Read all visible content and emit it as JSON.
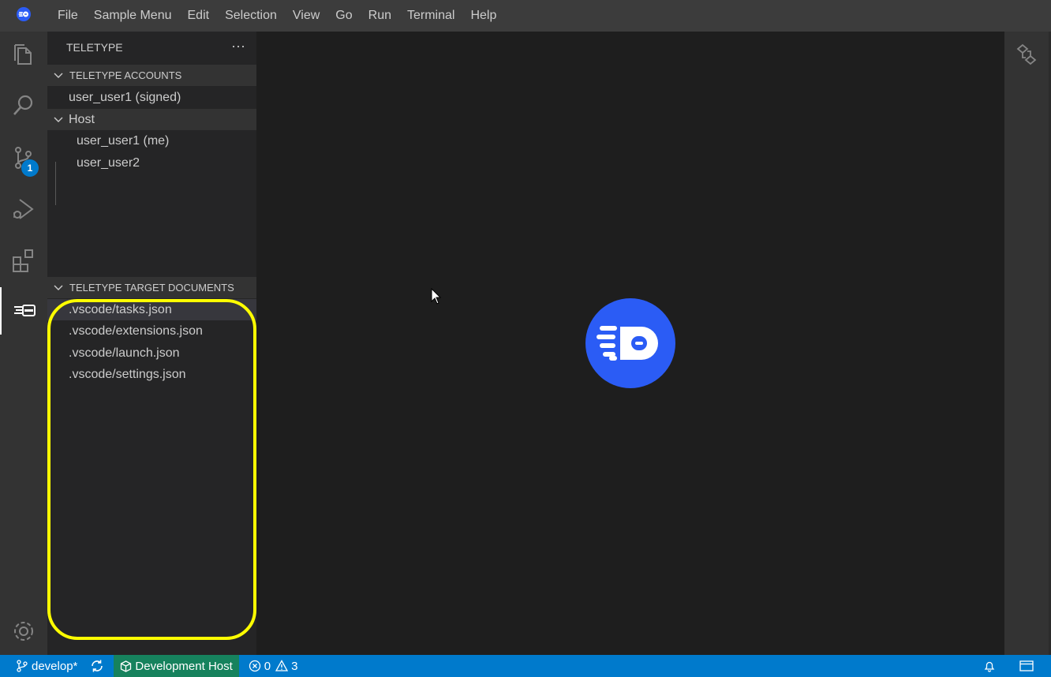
{
  "titlebar": {
    "menu": [
      "File",
      "Sample Menu",
      "Edit",
      "Selection",
      "View",
      "Go",
      "Run",
      "Terminal",
      "Help"
    ]
  },
  "activitybar": {
    "scm_badge": "1",
    "icons": [
      "explorer-icon",
      "search-icon",
      "source-control-icon",
      "run-debug-icon",
      "extensions-icon",
      "teletype-icon",
      "gear-icon"
    ]
  },
  "sidebar": {
    "title": "TELETYPE",
    "more": "···",
    "accounts": {
      "header": "TELETYPE ACCOUNTS",
      "items": [
        "user_user1 (signed)"
      ],
      "group": {
        "label": "Host",
        "children": [
          "user_user1 (me)",
          "user_user2"
        ]
      }
    },
    "documents": {
      "header": "TELETYPE TARGET DOCUMENTS",
      "items": [
        ".vscode/tasks.json",
        ".vscode/extensions.json",
        ".vscode/launch.json",
        ".vscode/settings.json"
      ]
    }
  },
  "statusbar": {
    "branch": "develop*",
    "host": "Development Host",
    "errors": "0",
    "warnings": "3"
  },
  "colors": {
    "accent": "#007acc",
    "host_bg": "#16825d",
    "highlight": "#ffff00",
    "logo": "#2b5cf5"
  }
}
